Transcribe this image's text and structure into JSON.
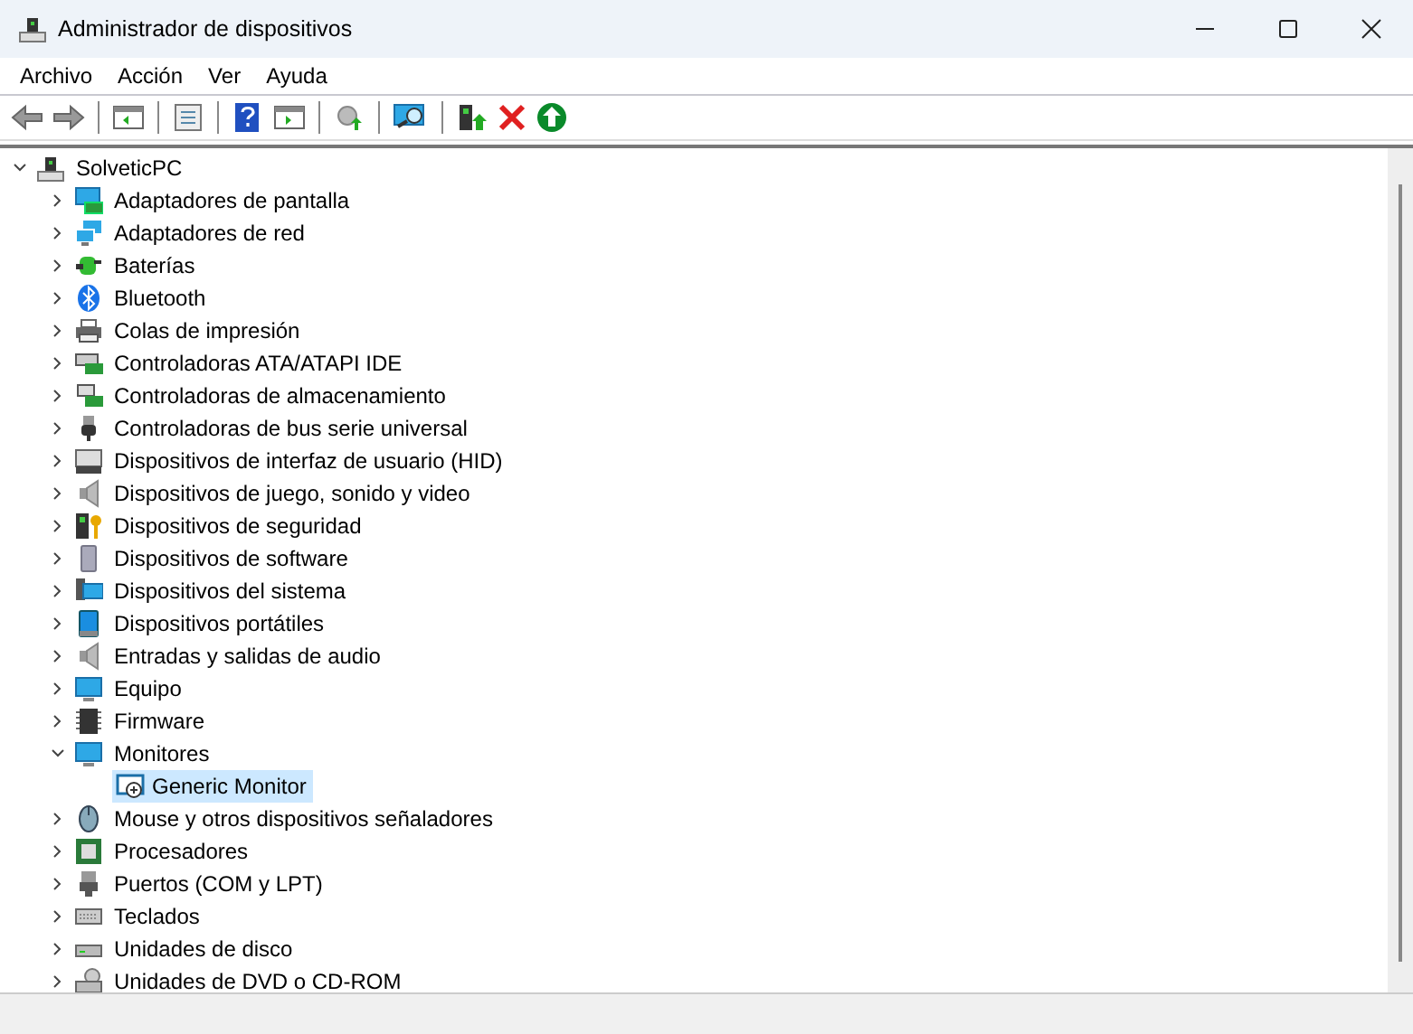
{
  "window": {
    "title": "Administrador de dispositivos"
  },
  "menu": [
    "Archivo",
    "Acción",
    "Ver",
    "Ayuda"
  ],
  "tree": {
    "label": "SolveticPC",
    "expanded": true,
    "selected": false,
    "children": [
      {
        "label": "Adaptadores de pantalla",
        "expanded": false,
        "selected": false
      },
      {
        "label": "Adaptadores de red",
        "expanded": false,
        "selected": false
      },
      {
        "label": "Baterías",
        "expanded": false,
        "selected": false
      },
      {
        "label": "Bluetooth",
        "expanded": false,
        "selected": false
      },
      {
        "label": "Colas de impresión",
        "expanded": false,
        "selected": false
      },
      {
        "label": "Controladoras ATA/ATAPI IDE",
        "expanded": false,
        "selected": false
      },
      {
        "label": "Controladoras de almacenamiento",
        "expanded": false,
        "selected": false
      },
      {
        "label": "Controladoras de bus serie universal",
        "expanded": false,
        "selected": false
      },
      {
        "label": "Dispositivos de interfaz de usuario (HID)",
        "expanded": false,
        "selected": false
      },
      {
        "label": "Dispositivos de juego, sonido y video",
        "expanded": false,
        "selected": false
      },
      {
        "label": "Dispositivos de seguridad",
        "expanded": false,
        "selected": false
      },
      {
        "label": "Dispositivos de software",
        "expanded": false,
        "selected": false
      },
      {
        "label": "Dispositivos del sistema",
        "expanded": false,
        "selected": false
      },
      {
        "label": "Dispositivos portátiles",
        "expanded": false,
        "selected": false
      },
      {
        "label": "Entradas y salidas de audio",
        "expanded": false,
        "selected": false
      },
      {
        "label": "Equipo",
        "expanded": false,
        "selected": false
      },
      {
        "label": "Firmware",
        "expanded": false,
        "selected": false
      },
      {
        "label": "Monitores",
        "expanded": true,
        "selected": false,
        "children": [
          {
            "label": "Generic Monitor",
            "selected": true
          }
        ]
      },
      {
        "label": "Mouse y otros dispositivos señaladores",
        "expanded": false,
        "selected": false
      },
      {
        "label": "Procesadores",
        "expanded": false,
        "selected": false
      },
      {
        "label": "Puertos (COM y LPT)",
        "expanded": false,
        "selected": false
      },
      {
        "label": "Teclados",
        "expanded": false,
        "selected": false
      },
      {
        "label": "Unidades de disco",
        "expanded": false,
        "selected": false
      },
      {
        "label": "Unidades de DVD o CD-ROM",
        "expanded": false,
        "selected": false
      }
    ]
  }
}
